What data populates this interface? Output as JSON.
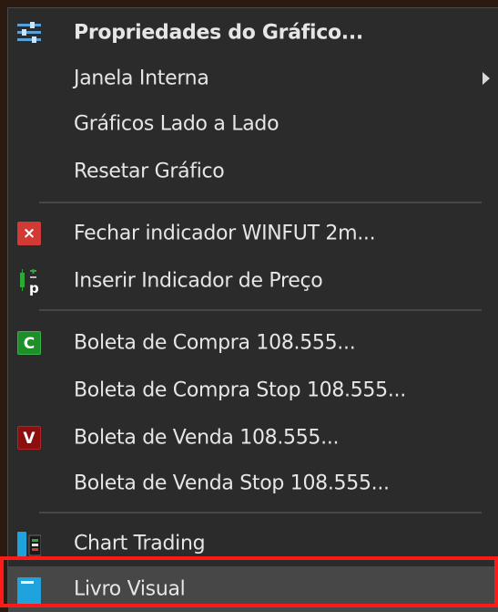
{
  "menu": {
    "items": [
      {
        "label": "Propriedades do Gráfico...",
        "icon": "sliders-icon"
      },
      {
        "label": "Janela Interna",
        "icon": "",
        "submenu": true
      },
      {
        "label": "Gráficos Lado a Lado",
        "icon": ""
      },
      {
        "label": "Resetar Gráfico",
        "icon": ""
      },
      {
        "label": "Fechar indicador WINFUT 2m...",
        "icon": "close-icon",
        "badge": "×"
      },
      {
        "label": "Inserir Indicador de Preço",
        "icon": "price-indicator-icon",
        "badge": "p"
      },
      {
        "label": "Boleta de Compra  108.555...",
        "icon": "buy-ticket-icon",
        "badge": "C"
      },
      {
        "label": "Boleta de Compra Stop  108.555...",
        "icon": ""
      },
      {
        "label": "Boleta de Venda   108.555...",
        "icon": "sell-ticket-icon",
        "badge": "V"
      },
      {
        "label": "Boleta de Venda Stop   108.555...",
        "icon": ""
      },
      {
        "label": "Chart Trading",
        "icon": "chart-trading-icon"
      },
      {
        "label": "Livro Visual",
        "icon": "visual-book-icon"
      }
    ]
  },
  "colors": {
    "menu_bg": "#2b2b2b",
    "text": "#e6e6e6",
    "separator": "#474747",
    "highlight_border": "#ff1a1a",
    "close_badge": "#d23a36",
    "buy_badge": "#1f8f2a",
    "sell_badge": "#8c0f0f",
    "accent_blue": "#1fa3dc"
  }
}
